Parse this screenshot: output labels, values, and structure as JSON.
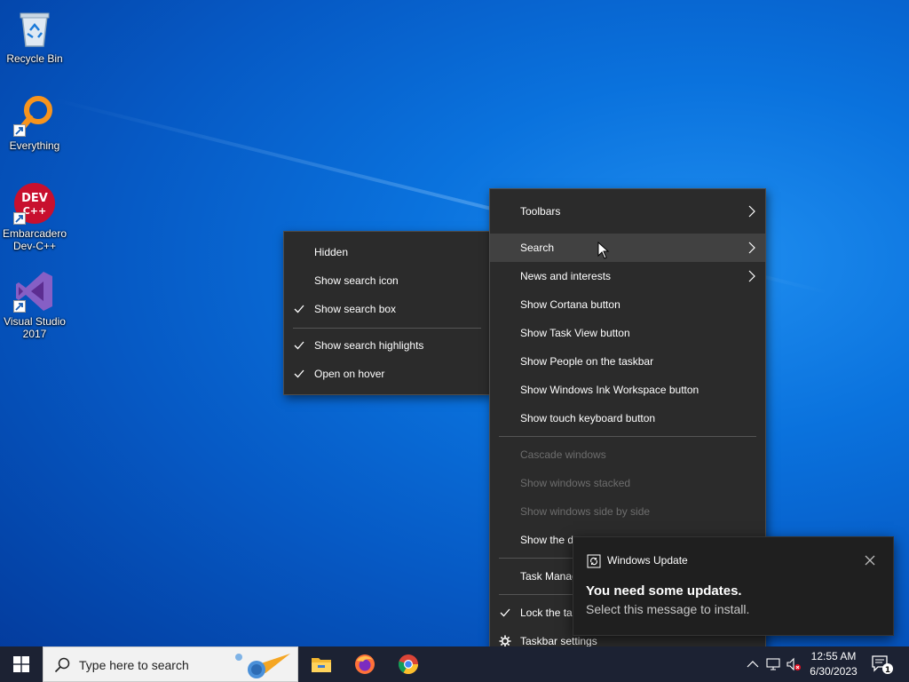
{
  "desktop": {
    "icons": [
      {
        "label": "Recycle Bin",
        "icon": "recycle-bin-icon"
      },
      {
        "label": "Everything",
        "icon": "everything-search-icon"
      },
      {
        "label": "Embarcadero Dev-C++",
        "icon": "devcpp-icon"
      },
      {
        "label": "Visual Studio 2017",
        "icon": "visual-studio-icon"
      }
    ],
    "devcpp_badge": {
      "line1": "DEV",
      "line2": "C++"
    }
  },
  "taskbar_menu": {
    "items": [
      {
        "label": "Toolbars",
        "submenu": true
      },
      {
        "label": "Search",
        "submenu": true,
        "highlighted": true
      },
      {
        "label": "News and interests",
        "submenu": true
      },
      {
        "label": "Show Cortana button"
      },
      {
        "label": "Show Task View button"
      },
      {
        "label": "Show People on the taskbar"
      },
      {
        "label": "Show Windows Ink Workspace button"
      },
      {
        "label": "Show touch keyboard button"
      },
      {
        "label": "Cascade windows",
        "disabled": true
      },
      {
        "label": "Show windows stacked",
        "disabled": true
      },
      {
        "label": "Show windows side by side",
        "disabled": true
      },
      {
        "label": "Show the d"
      },
      {
        "label": "Task Manag"
      },
      {
        "label": "Lock the ta",
        "checked": true
      },
      {
        "label": "Taskbar settings",
        "icon": "gear-icon"
      }
    ]
  },
  "search_submenu": {
    "items": [
      {
        "label": "Hidden"
      },
      {
        "label": "Show search icon"
      },
      {
        "label": "Show search box",
        "checked": true
      },
      {
        "label": "Show search highlights",
        "checked": true
      },
      {
        "label": "Open on hover",
        "checked": true
      }
    ]
  },
  "toast": {
    "app": "Windows Update",
    "title": "You need some updates.",
    "body": "Select this message to install."
  },
  "taskbar": {
    "search_placeholder": "Type here to search",
    "apps": [
      "file-explorer-icon",
      "firefox-icon",
      "chrome-icon"
    ],
    "clock_time": "12:55 AM",
    "clock_date": "6/30/2023",
    "notification_count": "1"
  },
  "colors": {
    "menu_bg": "#2b2b2b",
    "menu_highlight": "#414141",
    "disabled_text": "#6d6d6d",
    "taskbar_bg": "#1c2233",
    "toast_bg": "#1f1f1f"
  }
}
